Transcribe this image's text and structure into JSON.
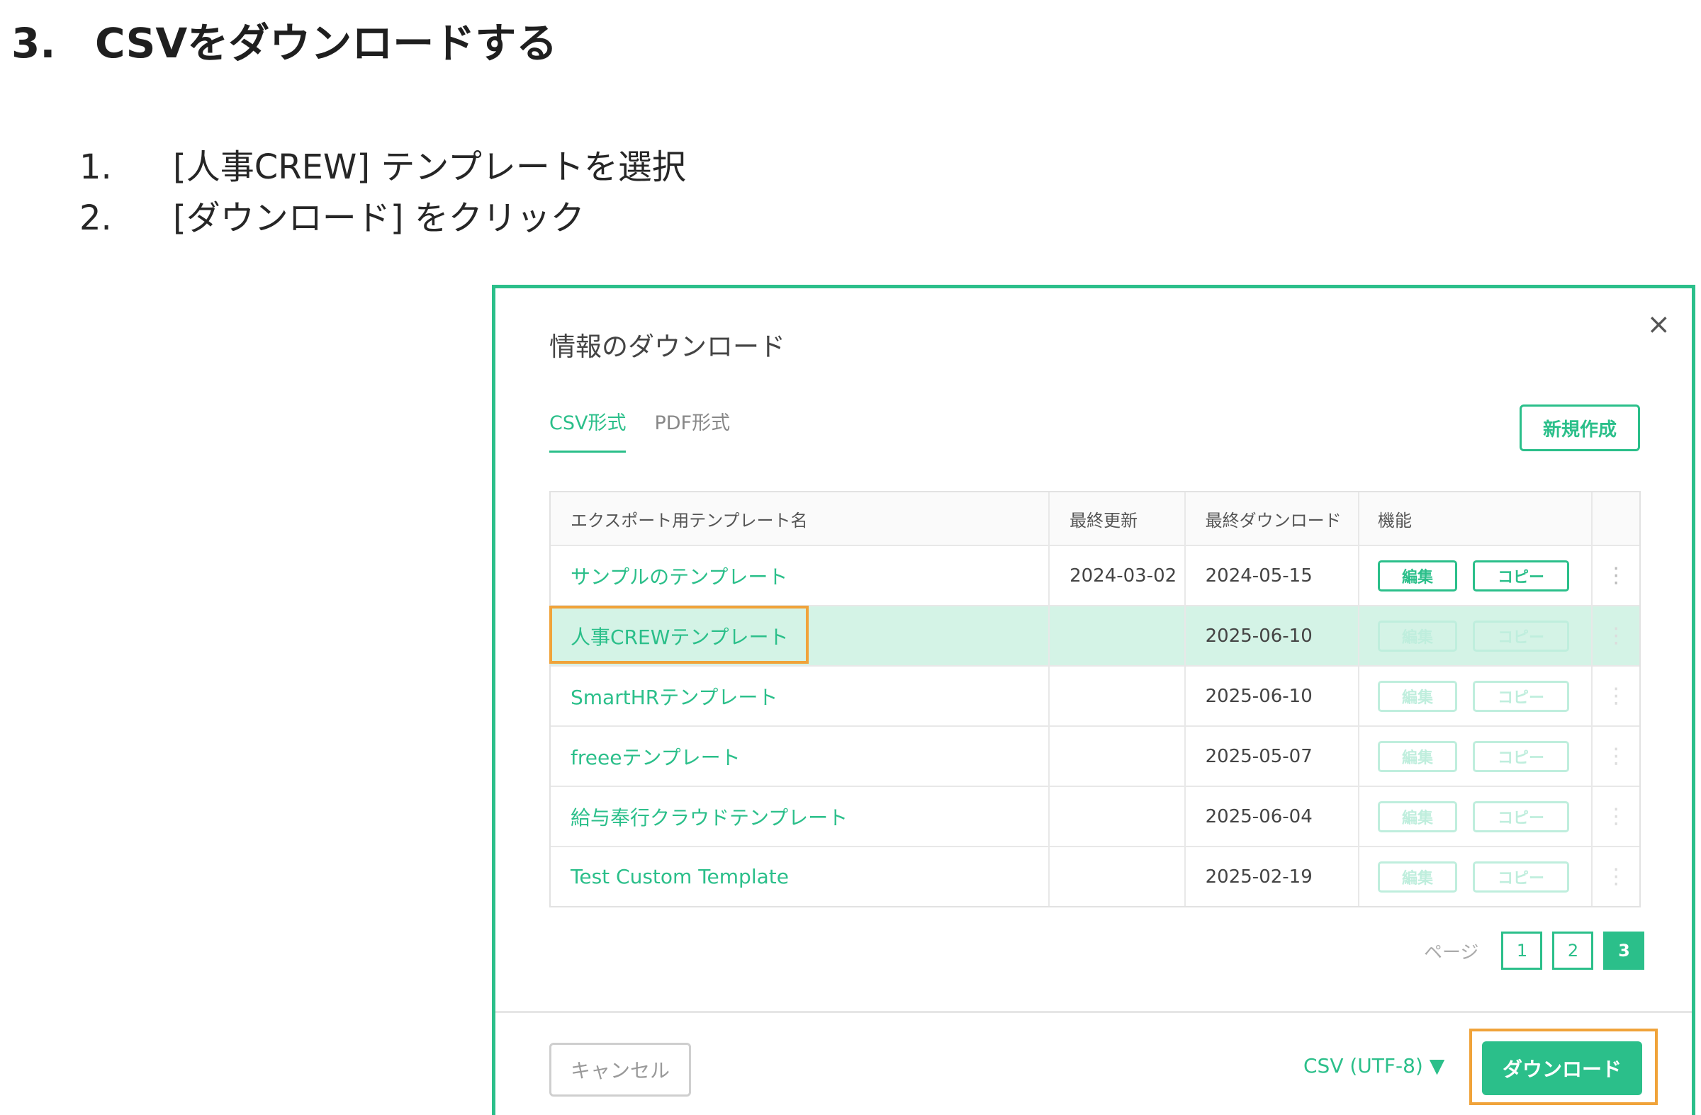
{
  "heading": {
    "number": "3.",
    "text": "CSVをダウンロードする"
  },
  "steps": [
    {
      "n": "1.",
      "text": "[人事CREW] テンプレートを選択"
    },
    {
      "n": "2.",
      "text": "[ダウンロード] をクリック"
    }
  ],
  "modal": {
    "title": "情報のダウンロード",
    "close": "×",
    "tabs": [
      "CSV形式",
      "PDF形式"
    ],
    "active_tab": "CSV形式",
    "new_button": "新規作成",
    "columns": [
      "エクスポート用テンプレート名",
      "最終更新",
      "最終ダウンロード",
      "機能"
    ],
    "rows": [
      {
        "name": "サンプルのテンプレート",
        "updated": "2024-03-02",
        "downloaded": "2024-05-15",
        "edit": "編集",
        "copy": "コピー",
        "menu": "⋮"
      },
      {
        "name": "人事CREWテンプレート",
        "updated": "",
        "downloaded": "2025-06-10",
        "edit": "編集",
        "copy": "コピー",
        "menu": "⋮"
      },
      {
        "name": "SmartHRテンプレート",
        "updated": "",
        "downloaded": "2025-06-10",
        "edit": "編集",
        "copy": "コピー",
        "menu": "⋮"
      },
      {
        "name": "freeeテンプレート",
        "updated": "",
        "downloaded": "2025-05-07",
        "edit": "編集",
        "copy": "コピー",
        "menu": "⋮"
      },
      {
        "name": "給与奉行クラウドテンプレート",
        "updated": "",
        "downloaded": "2025-06-04",
        "edit": "編集",
        "copy": "コピー",
        "menu": "⋮"
      },
      {
        "name": "Test Custom Template",
        "updated": "",
        "downloaded": "2025-02-19",
        "edit": "編集",
        "copy": "コピー",
        "menu": "⋮"
      }
    ],
    "pager": {
      "label": "ページ",
      "pages": [
        "1",
        "2",
        "3"
      ],
      "current": "3"
    },
    "cancel_button": "キャンセル",
    "format_select": "CSV (UTF-8) ▼",
    "download_button": "ダウンロード"
  },
  "colors": {
    "accent": "#2bbf8a",
    "highlight": "#f0a33a",
    "selected_row": "#d4f3e6"
  }
}
